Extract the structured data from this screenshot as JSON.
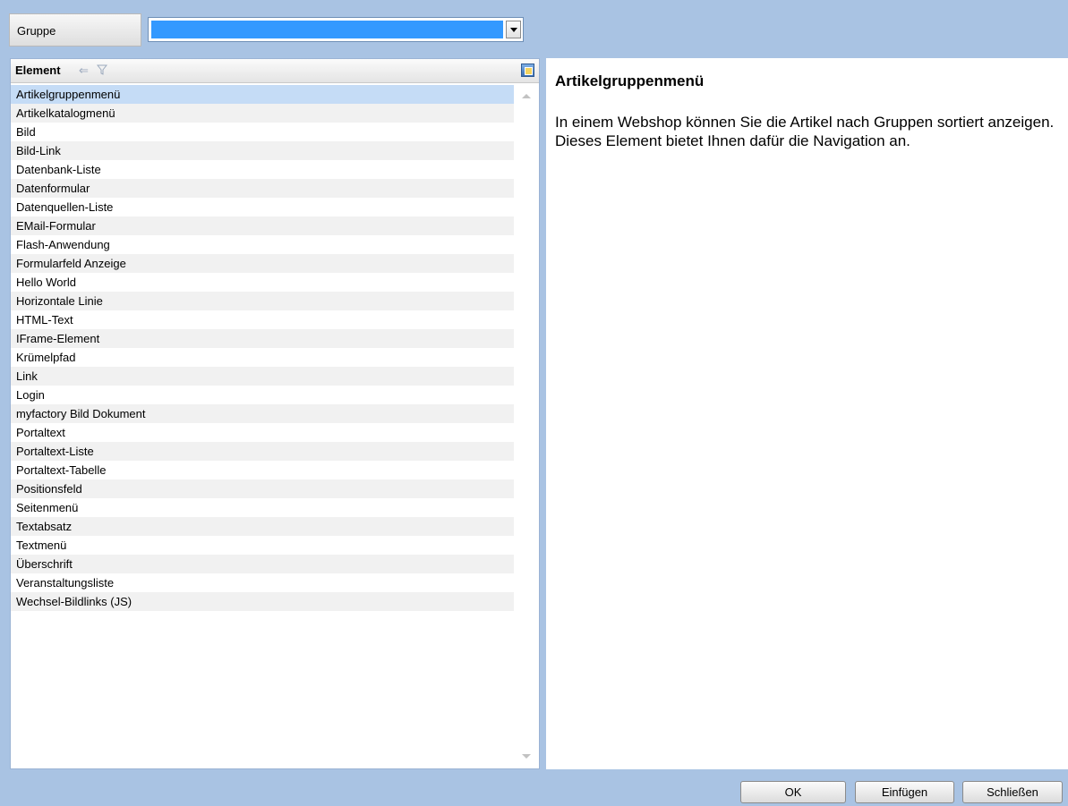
{
  "group": {
    "label": "Gruppe",
    "selected_value": ""
  },
  "list": {
    "header": "Element",
    "selected_index": 0,
    "items": [
      "Artikelgruppenmenü",
      "Artikelkatalogmenü",
      "Bild",
      "Bild-Link",
      "Datenbank-Liste",
      "Datenformular",
      "Datenquellen-Liste",
      "EMail-Formular",
      "Flash-Anwendung",
      "Formularfeld Anzeige",
      "Hello World",
      "Horizontale Linie",
      "HTML-Text",
      "IFrame-Element",
      "Krümelpfad",
      "Link",
      "Login",
      "myfactory Bild Dokument",
      "Portaltext",
      "Portaltext-Liste",
      "Portaltext-Tabelle",
      "Positionsfeld",
      "Seitenmenü",
      "Textabsatz",
      "Textmenü",
      "Überschrift",
      "Veranstaltungsliste",
      "Wechsel-Bildlinks (JS)"
    ]
  },
  "description": {
    "title": "Artikelgruppenmenü",
    "text": "In einem Webshop können Sie die Artikel nach Gruppen sortiert anzeigen. Dieses Element bietet Ihnen dafür die Navigation an."
  },
  "buttons": {
    "ok": "OK",
    "insert": "Einfügen",
    "close": "Schließen"
  },
  "icons": {
    "sort": "sort-icon",
    "filter": "filter-icon",
    "columns": "column-chooser-icon",
    "dropdown": "chevron-down-icon"
  },
  "colors": {
    "background": "#a9c3e3",
    "selection": "#c5dcf6",
    "select_fill": "#3399ff"
  }
}
